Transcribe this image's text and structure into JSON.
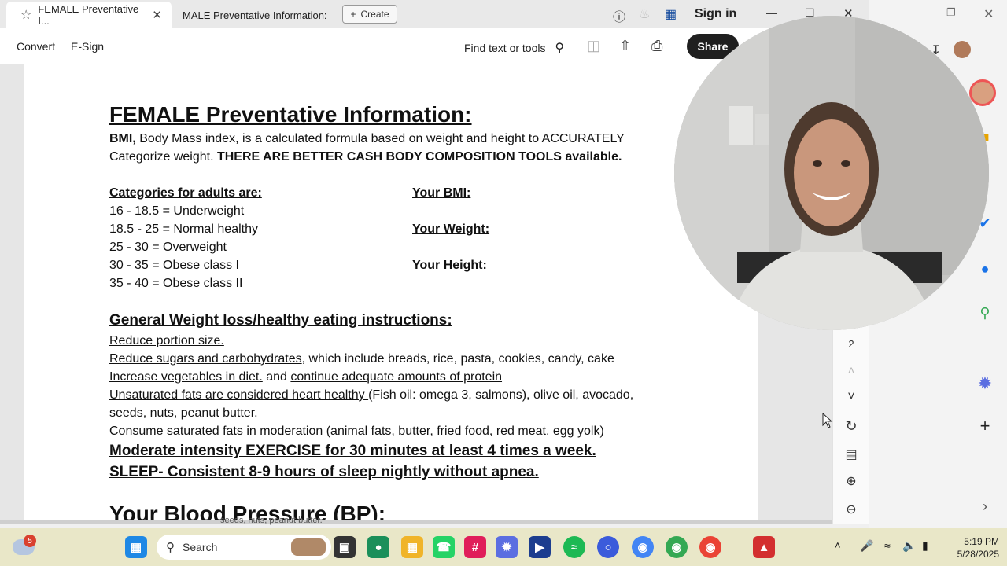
{
  "tabs": [
    {
      "label": "FEMALE Preventative I...",
      "active": true
    },
    {
      "label": "MALE Preventative Information:",
      "active": false
    }
  ],
  "create_label": "Create",
  "signin_label": "Sign in",
  "toolbar": {
    "convert": "Convert",
    "esign": "E-Sign",
    "find": "Find text or tools",
    "share": "Share"
  },
  "document": {
    "title": "FEMALE Preventative Information:",
    "bmi_bold": "BMI,",
    "bmi_text": " Body Mass index, is a calculated formula based on weight and height to ACCURATELY",
    "bmi_line2": "Categorize weight.  ",
    "bmi_line2_bold": "THERE ARE BETTER  CASH  BODY COMPOSITION TOOLS available.",
    "categories_heading": "Categories for adults are:",
    "categories": [
      "16 - 18.5  = Underweight",
      "18.5 - 25  = Normal healthy",
      "25 - 30 = Overweight",
      "30 - 35 = Obese class I",
      "35 - 40 = Obese class II"
    ],
    "your_bmi": "Your BMI:",
    "your_weight": "Your Weight:",
    "your_height": "Your Height:",
    "weight_heading": "General Weight loss/healthy eating instructions:",
    "instr1": "Reduce portion size.",
    "instr2_u": "Reduce sugars and carbohydrates",
    "instr2_t": ", which include breads, rice, pasta, cookies, candy, cake",
    "instr3_u": "Increase vegetables in diet.",
    "instr3_t": " and ",
    "instr3_u2": "continue adequate amounts of protein",
    "instr4_u": "Unsaturated fats are considered heart healthy ",
    "instr4_t": "(Fish oil: omega 3, salmons), olive oil,  avocado,",
    "instr4_line2": "seeds, nuts, peanut butter.",
    "instr5_u": "Consume saturated fats in moderation",
    "instr5_t": " (animal fats, butter, fried food, red meat, egg yolk)",
    "exercise": "Moderate intensity EXERCISE for 30 minutes at least 4 times a week.",
    "sleep": "SLEEP- Consistent 8-9 hours of sleep nightly without apnea.",
    "bp_heading": "Your Blood Pressure (BP):",
    "clipped_text": "seeds, nuts, peanut butter."
  },
  "rail": {
    "page_number": "2"
  },
  "taskbar": {
    "search": "Search",
    "weather_badge": "5",
    "time": "5:19 PM",
    "date": "5/28/2025"
  },
  "icons": {
    "tab_star": "star-icon",
    "help": "help-icon",
    "bell": "bell-icon",
    "apps": "apps-grid-icon"
  }
}
